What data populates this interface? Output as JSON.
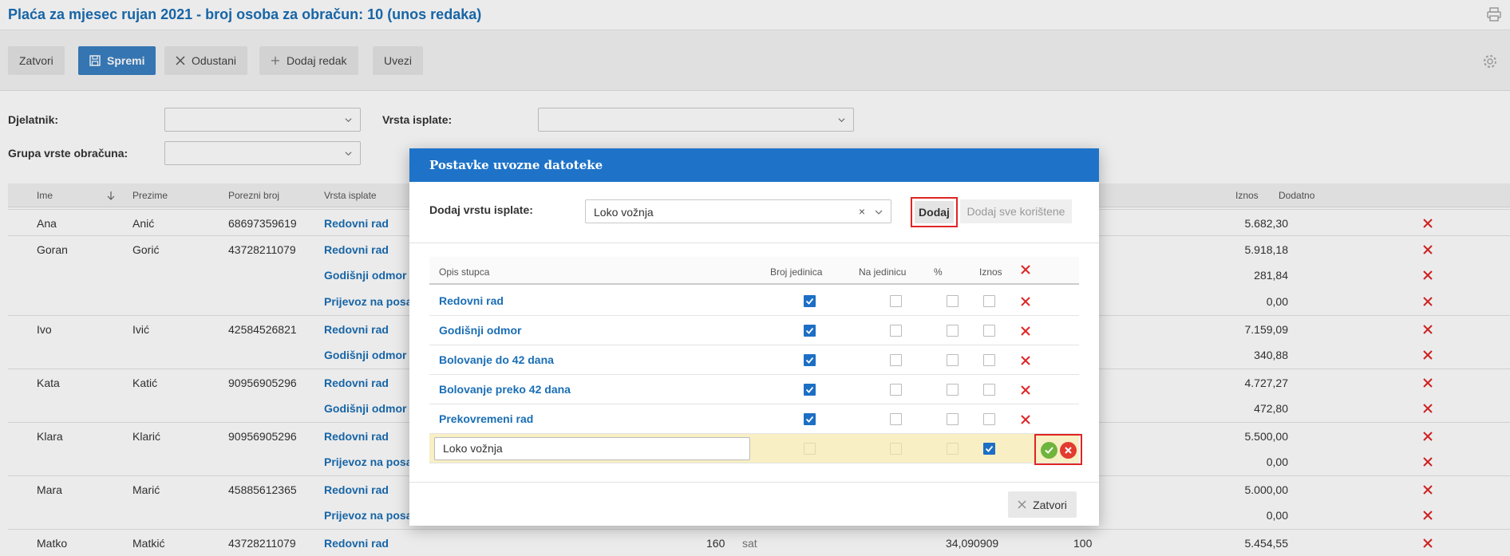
{
  "header": {
    "title": "Plaća za mjesec rujan 2021 - broj osoba za obračun: 10 (unos redaka)"
  },
  "toolbar": {
    "close_label": "Zatvori",
    "save_label": "Spremi",
    "cancel_label": "Odustani",
    "add_row_label": "Dodaj redak",
    "import_label": "Uvezi"
  },
  "filters": {
    "employee_label": "Djelatnik:",
    "payment_type_label": "Vrsta isplate:",
    "calc_group_label": "Grupa vrste obračuna:"
  },
  "grid": {
    "columns": {
      "first_name": "Ime",
      "last_name": "Prezime",
      "tax_number": "Porezni broj",
      "payment_type": "Vrsta isplate",
      "amount": "Iznos",
      "extra": "Dodatno"
    },
    "rows": [
      {
        "first_name": "Ana",
        "last_name": "Anić",
        "tax": "68697359619",
        "type": "Redovni rad",
        "amount": "5.682,30"
      },
      {
        "first_name": "Goran",
        "last_name": "Gorić",
        "tax": "43728211079",
        "type": "Redovni rad",
        "amount": "5.918,18"
      },
      {
        "first_name": "",
        "last_name": "",
        "tax": "",
        "type": "Godišnji odmor",
        "amount": "281,84"
      },
      {
        "first_name": "",
        "last_name": "",
        "tax": "",
        "type": "Prijevoz na posao",
        "amount": "0,00"
      },
      {
        "first_name": "Ivo",
        "last_name": "Ivić",
        "tax": "42584526821",
        "type": "Redovni rad",
        "amount": "7.159,09"
      },
      {
        "first_name": "",
        "last_name": "",
        "tax": "",
        "type": "Godišnji odmor",
        "amount": "340,88"
      },
      {
        "first_name": "Kata",
        "last_name": "Katić",
        "tax": "90956905296",
        "type": "Redovni rad",
        "amount": "4.727,27"
      },
      {
        "first_name": "",
        "last_name": "",
        "tax": "",
        "type": "Godišnji odmor",
        "amount": "472,80"
      },
      {
        "first_name": "Klara",
        "last_name": "Klarić",
        "tax": "90956905296",
        "type": "Redovni rad",
        "amount": "5.500,00"
      },
      {
        "first_name": "",
        "last_name": "",
        "tax": "",
        "type": "Prijevoz na posao",
        "amount": "0,00"
      },
      {
        "first_name": "Mara",
        "last_name": "Marić",
        "tax": "45885612365",
        "type": "Redovni rad",
        "amount": "5.000,00"
      },
      {
        "first_name": "",
        "last_name": "",
        "tax": "",
        "type": "Prijevoz na posao",
        "amount": "0,00"
      },
      {
        "first_name": "Matko",
        "last_name": "Matkić",
        "tax": "43728211079",
        "type": "Redovni rad",
        "amount": "5.454,55",
        "units": "160",
        "unit": "sat",
        "per_unit": "34,090909",
        "percent": "100"
      }
    ]
  },
  "modal": {
    "title": "Postavke uvozne datoteke",
    "add_type_label": "Dodaj vrstu isplate:",
    "add_type_value": "Loko vožnja",
    "add_button": "Dodaj",
    "add_all_button": "Dodaj sve korištene",
    "columns": {
      "description": "Opis stupca",
      "units": "Broj jedinica",
      "per_unit": "Na jedinicu",
      "percent": "%",
      "amount": "Iznos"
    },
    "rows": [
      {
        "name": "Redovni rad",
        "units": true,
        "per_unit": false,
        "percent": false,
        "amount": false
      },
      {
        "name": "Godišnji odmor",
        "units": true,
        "per_unit": false,
        "percent": false,
        "amount": false
      },
      {
        "name": "Bolovanje do 42 dana",
        "units": true,
        "per_unit": false,
        "percent": false,
        "amount": false
      },
      {
        "name": "Bolovanje preko 42 dana",
        "units": true,
        "per_unit": false,
        "percent": false,
        "amount": false
      },
      {
        "name": "Prekovremeni rad",
        "units": true,
        "per_unit": false,
        "percent": false,
        "amount": false
      }
    ],
    "edit_row": {
      "value": "Loko vožnja",
      "amount": true
    },
    "close_button": "Zatvori"
  },
  "colors": {
    "brand": "#1e73c8",
    "link": "#1a6eb5",
    "delete": "#e02424",
    "ok": "#6fb43c"
  }
}
